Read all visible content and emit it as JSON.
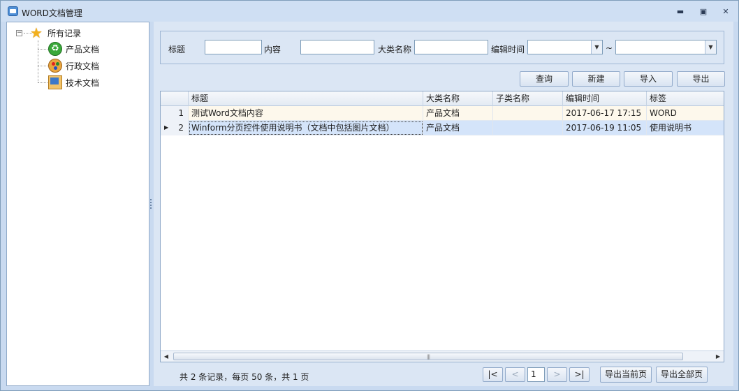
{
  "window": {
    "title": "WORD文档管理"
  },
  "tree": {
    "root": {
      "label": "所有记录",
      "icon": "star-icon"
    },
    "children": [
      {
        "label": "产品文档",
        "icon": "recycle-icon"
      },
      {
        "label": "行政文档",
        "icon": "palette-icon"
      },
      {
        "label": "技术文档",
        "icon": "document-icon"
      }
    ]
  },
  "filters": {
    "title_label": "标题",
    "content_label": "内容",
    "category_label": "大类名称",
    "edit_time_label": "编辑时间",
    "range_sep": "~",
    "title_value": "",
    "content_value": "",
    "category_value": "",
    "time_from_value": "",
    "time_to_value": ""
  },
  "toolbar": {
    "query": "查询",
    "new": "新建",
    "import": "导入",
    "export": "导出"
  },
  "grid": {
    "columns": [
      "标题",
      "大类名称",
      "子类名称",
      "编辑时间",
      "标签"
    ],
    "rows": [
      {
        "num": "1",
        "title": "测试Word文档内容",
        "category": "产品文档",
        "subcategory": "",
        "edit_time": "2017-06-17 17:15",
        "tag": "WORD"
      },
      {
        "num": "2",
        "title": "Winform分页控件使用说明书（文档中包括图片文档）",
        "category": "产品文档",
        "subcategory": "",
        "edit_time": "2017-06-19 11:05",
        "tag": "使用说明书"
      }
    ],
    "selected_row": 2
  },
  "pager": {
    "summary": "共 2 条记录，每页 50 条，共 1 页",
    "first": "|<",
    "prev": "<",
    "page": "1",
    "next": ">",
    "last": ">|",
    "export_current": "导出当前页",
    "export_all": "导出全部页"
  }
}
